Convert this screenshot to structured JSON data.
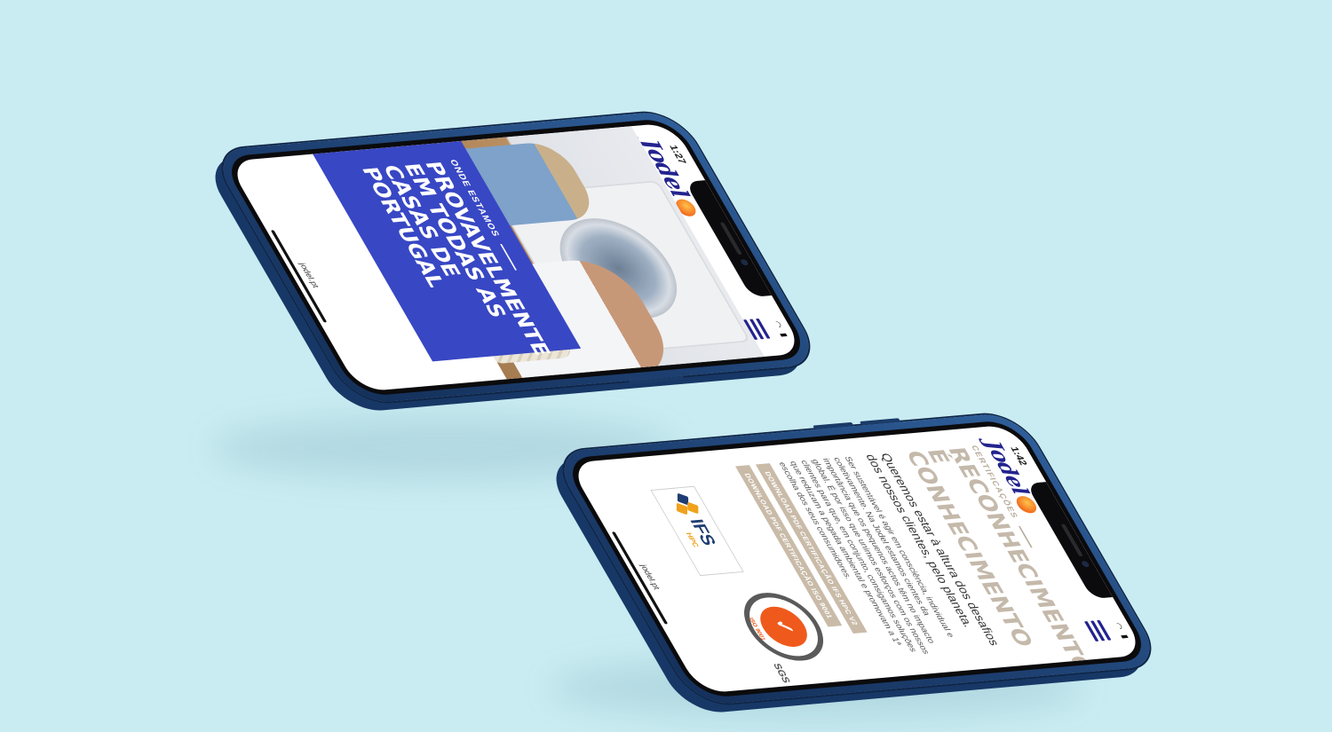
{
  "phone1": {
    "status_time": "1:27",
    "logo_text": "Jodel",
    "menu_icon": "hamburger-menu-icon",
    "hero": {
      "eyebrow": "ONDE ESTAMOS",
      "title": "PROVAVELMENTE EM TODAS AS CASAS DE PORTUGAL"
    },
    "url": "jodel.pt"
  },
  "phone2": {
    "status_time": "1:42",
    "logo_text": "Jodel",
    "menu_icon": "hamburger-menu-icon",
    "eyebrow": "CERTIFICAÇÕES",
    "title": "RECONHECIMENTO É CONHECIMENTO",
    "lead": "Queremos estar à altura dos desafios dos nossos clientes, pelo planeta.",
    "body": "Ser sustentável é agir em consciência, individual e coletivamente. Na Jodel estamos cientes da importância que os pequenos actos têm no impacto global. É por isso que unimos esforços com os nossos clientes para que, em conjunto, consigamos soluções que reduzam a pegada ambiental e promovam a 1ª escolha dos seus consumidores.",
    "download_ifs": "DOWNLOAD PDF CERTIFICAÇÃO IFS HPC V2",
    "download_iso": "DOWNLOAD PDF CERTIFICAÇÃO ISO 9001",
    "sgs_badge": {
      "iso": "ISO 9001",
      "brand": "SGS"
    },
    "ifs_badge": {
      "text": "IFS",
      "sub": "HPC"
    },
    "url": "jodel.pt"
  },
  "colors": {
    "background": "#c9ecf2",
    "brand_blue": "#23238f",
    "hero_blue": "#3847c4",
    "beige": "#c4b9aa",
    "accent_orange": "#ef5a1c",
    "phone_body": "#1d3f70"
  }
}
